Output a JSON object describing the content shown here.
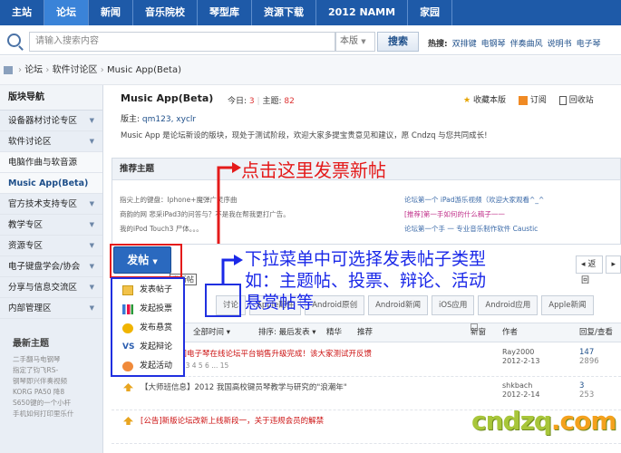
{
  "topnav": {
    "items": [
      "主站",
      "论坛",
      "新闻",
      "音乐院校",
      "琴型库",
      "资源下载",
      "2012 NAMM",
      "家园"
    ],
    "active": 1
  },
  "search": {
    "placeholder": "请输入搜索内容",
    "scope": "本版",
    "button": "搜索",
    "hot_label": "热搜:",
    "hot": [
      "双排键",
      "电钢琴",
      "伴奏曲风",
      "说明书",
      "电子琴"
    ]
  },
  "breadcrumb": {
    "items": [
      "论坛",
      "软件讨论区",
      "Music App(Beta)"
    ]
  },
  "sidebar": {
    "title": "版块导航",
    "items": [
      {
        "label": "设备器材讨论专区",
        "arrow": "▼",
        "kind": "top"
      },
      {
        "label": "软件讨论区",
        "arrow": "▼",
        "kind": "top"
      },
      {
        "label": "电脑作曲与软音源",
        "arrow": "",
        "kind": "sub"
      },
      {
        "label": "Music App(Beta)",
        "arrow": "",
        "kind": "cur"
      },
      {
        "label": "官方技术支持专区",
        "arrow": "▼",
        "kind": "top"
      },
      {
        "label": "教学专区",
        "arrow": "▼",
        "kind": "top"
      },
      {
        "label": "资源专区",
        "arrow": "▼",
        "kind": "top"
      },
      {
        "label": "电子键盘学会/协会",
        "arrow": "▼",
        "kind": "top"
      },
      {
        "label": "分享与信息交流区",
        "arrow": "▼",
        "kind": "top"
      },
      {
        "label": "内部管理区",
        "arrow": "▼",
        "kind": "top"
      }
    ],
    "new_title": "最新主题",
    "new_list": [
      "二手翻马电钢琴",
      "指定了钧飞RS-",
      "钢琴即兴伴奏视频",
      "KORG PA50 降8",
      "S650键的一个小杆",
      "手机如何打印里乐什"
    ]
  },
  "forum": {
    "title": "Music App(Beta)",
    "today_label": "今日:",
    "today": "3",
    "topics_label": "主题:",
    "topics": "82",
    "fav": "收藏本版",
    "rss": "订阅",
    "trash": "回收站",
    "mods_label": "版主:",
    "mods": "qm123, xyclr",
    "desc": "Music App 是论坛新设的版块，现处于测试阶段，欢迎大家多提宝贵意见和建议，愿 Cndzq 与您共同成长!"
  },
  "recommend": {
    "title": "推荐主题",
    "left": [
      "指尖上的键盘：Iphone+魔弹广灵序曲",
      "商韵的网 悲采iPad3的问答与？不是我在帮我更打广告。",
      "我的iPod Touch3 尸体。。。"
    ],
    "right": [
      "论坛第一个 iPad游乐视频（欢迎大家观看^_^",
      "[推荐]第一手如何的什么稿子一一",
      "论坛第一个手 一 专业音乐制作软件 Caustic"
    ]
  },
  "post_button": "发帖",
  "tooltip": "发新帖",
  "pager": {
    "back": "◂ 返回",
    "label": "1"
  },
  "tags": [
    "讨论",
    "Apple配件",
    "Android原创",
    "Android新闻",
    "iOS应用",
    "Android应用",
    "Apple新闻"
  ],
  "filter": {
    "all": "全部",
    "time": "全部时间 ▾",
    "order": "排序: 最后发表 ▾",
    "digest": "精华",
    "recommend": "推荐",
    "new": "新窗",
    "author": "作者",
    "reply": "回复/查看"
  },
  "threads": [
    {
      "title": "【公告】中国电子琴在线论坛平台销售升级完成！该大家测试开反馈",
      "sub": "反馈区 ... 2 3 4 5 6 ... 15",
      "author": "Ray2000",
      "date": "2012-2-13",
      "reply": "147",
      "view": "2896",
      "color": "#cc1111"
    },
    {
      "title": "【大师班信息】2012 我国高校键员琴教学与研究的\"浪潮年\"",
      "sub": "",
      "author": "shkbach",
      "date": "2012-2-14",
      "reply": "3",
      "view": "253",
      "color": "#444"
    },
    {
      "title": "[公告]新版论坛改新上线新段一，关于违规会员的解禁",
      "sub": "",
      "author": "",
      "date": "",
      "reply": "",
      "view": "",
      "color": "#cc1111"
    }
  ],
  "dropdown": {
    "items": [
      {
        "label": "发表帖子",
        "icon": "doc"
      },
      {
        "label": "发起投票",
        "icon": "bar"
      },
      {
        "label": "发布悬赏",
        "icon": "coin"
      },
      {
        "label": "发起辩论",
        "icon": "vs"
      },
      {
        "label": "发起活动",
        "icon": "act"
      }
    ]
  },
  "annotation": {
    "red": "点击这里发票新帖",
    "blue": [
      "下拉菜单中可选择发表帖子类型",
      "如：主题帖、投票、辩论、活动",
      "悬赏帖等"
    ]
  },
  "watermark": {
    "a": "cndzq",
    "b": ".com"
  }
}
